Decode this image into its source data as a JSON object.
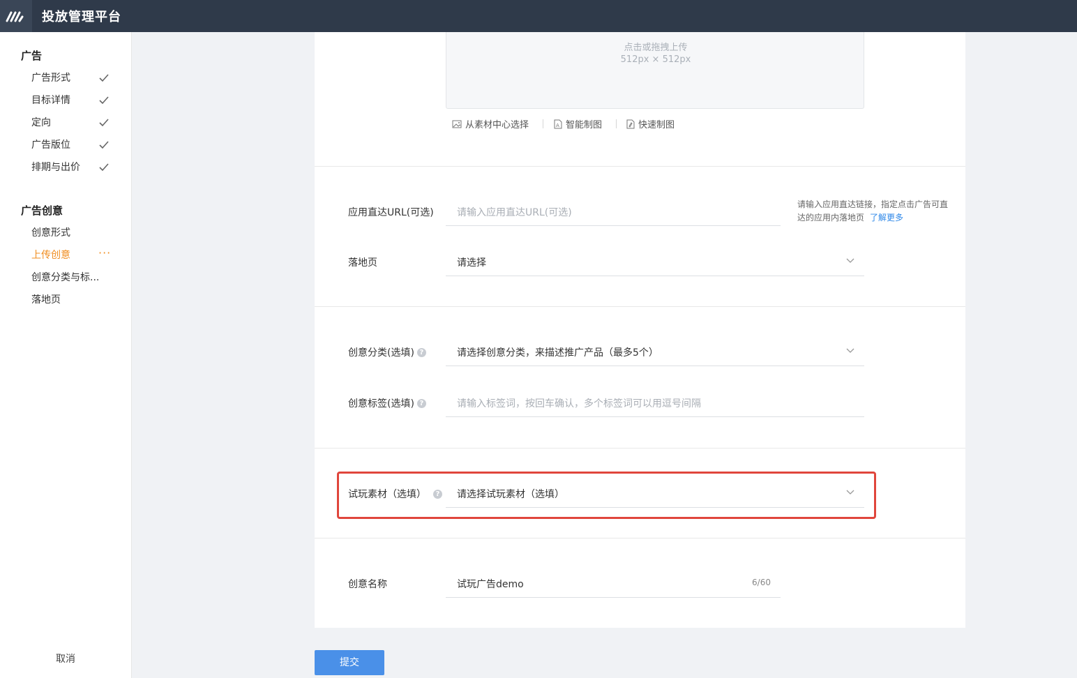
{
  "header": {
    "title": "投放管理平台",
    "logo_icon": "brand-logo-icon"
  },
  "sidebar": {
    "groups": [
      {
        "title": "广告",
        "items": [
          {
            "label": "广告形式",
            "status": "check-icon"
          },
          {
            "label": "目标详情",
            "status": "check-icon"
          },
          {
            "label": "定向",
            "status": "check-icon"
          },
          {
            "label": "广告版位",
            "status": "check-icon"
          },
          {
            "label": "排期与出价",
            "status": "check-icon"
          }
        ]
      },
      {
        "title": "广告创意",
        "items": [
          {
            "label": "创意形式"
          },
          {
            "label": "上传创意",
            "active": true,
            "status_text": "···"
          },
          {
            "label": "创意分类与标..."
          },
          {
            "label": "落地页"
          }
        ]
      }
    ],
    "cancel_label": "取消"
  },
  "upload": {
    "prompt": "点击或拖拽上传",
    "size": "512px × 512px",
    "actions": [
      {
        "label": "从素材中心选择",
        "icon": "image-icon"
      },
      {
        "label": "智能制图",
        "icon": "document-a-icon"
      },
      {
        "label": "快速制图",
        "icon": "document-pen-icon"
      }
    ]
  },
  "form": {
    "app_url": {
      "label": "应用直达URL(可选)",
      "placeholder": "请输入应用直达URL(可选)"
    },
    "app_url_hint": {
      "text": "请输入应用直达链接，指定点击广告可直达的应用内落地页",
      "link": "了解更多"
    },
    "landing_page": {
      "label": "落地页",
      "value": "请选择"
    },
    "category": {
      "label": "创意分类(选填)",
      "value": "请选择创意分类，来描述推广产品（最多5个）"
    },
    "tags": {
      "label": "创意标签(选填)",
      "placeholder": "请输入标签词，按回车确认，多个标签词可以用逗号间隔"
    },
    "playable": {
      "label": "试玩素材（选填）",
      "value": "请选择试玩素材（选填）"
    },
    "creative_name": {
      "label": "创意名称",
      "value": "试玩广告demo",
      "counter": "6/60"
    }
  },
  "submit_label": "提交",
  "colors": {
    "topbar": "#2f3a4a",
    "accent": "#f08c1e",
    "primary": "#4a90e8",
    "highlight": "#e0463c",
    "link": "#2f88e8"
  }
}
